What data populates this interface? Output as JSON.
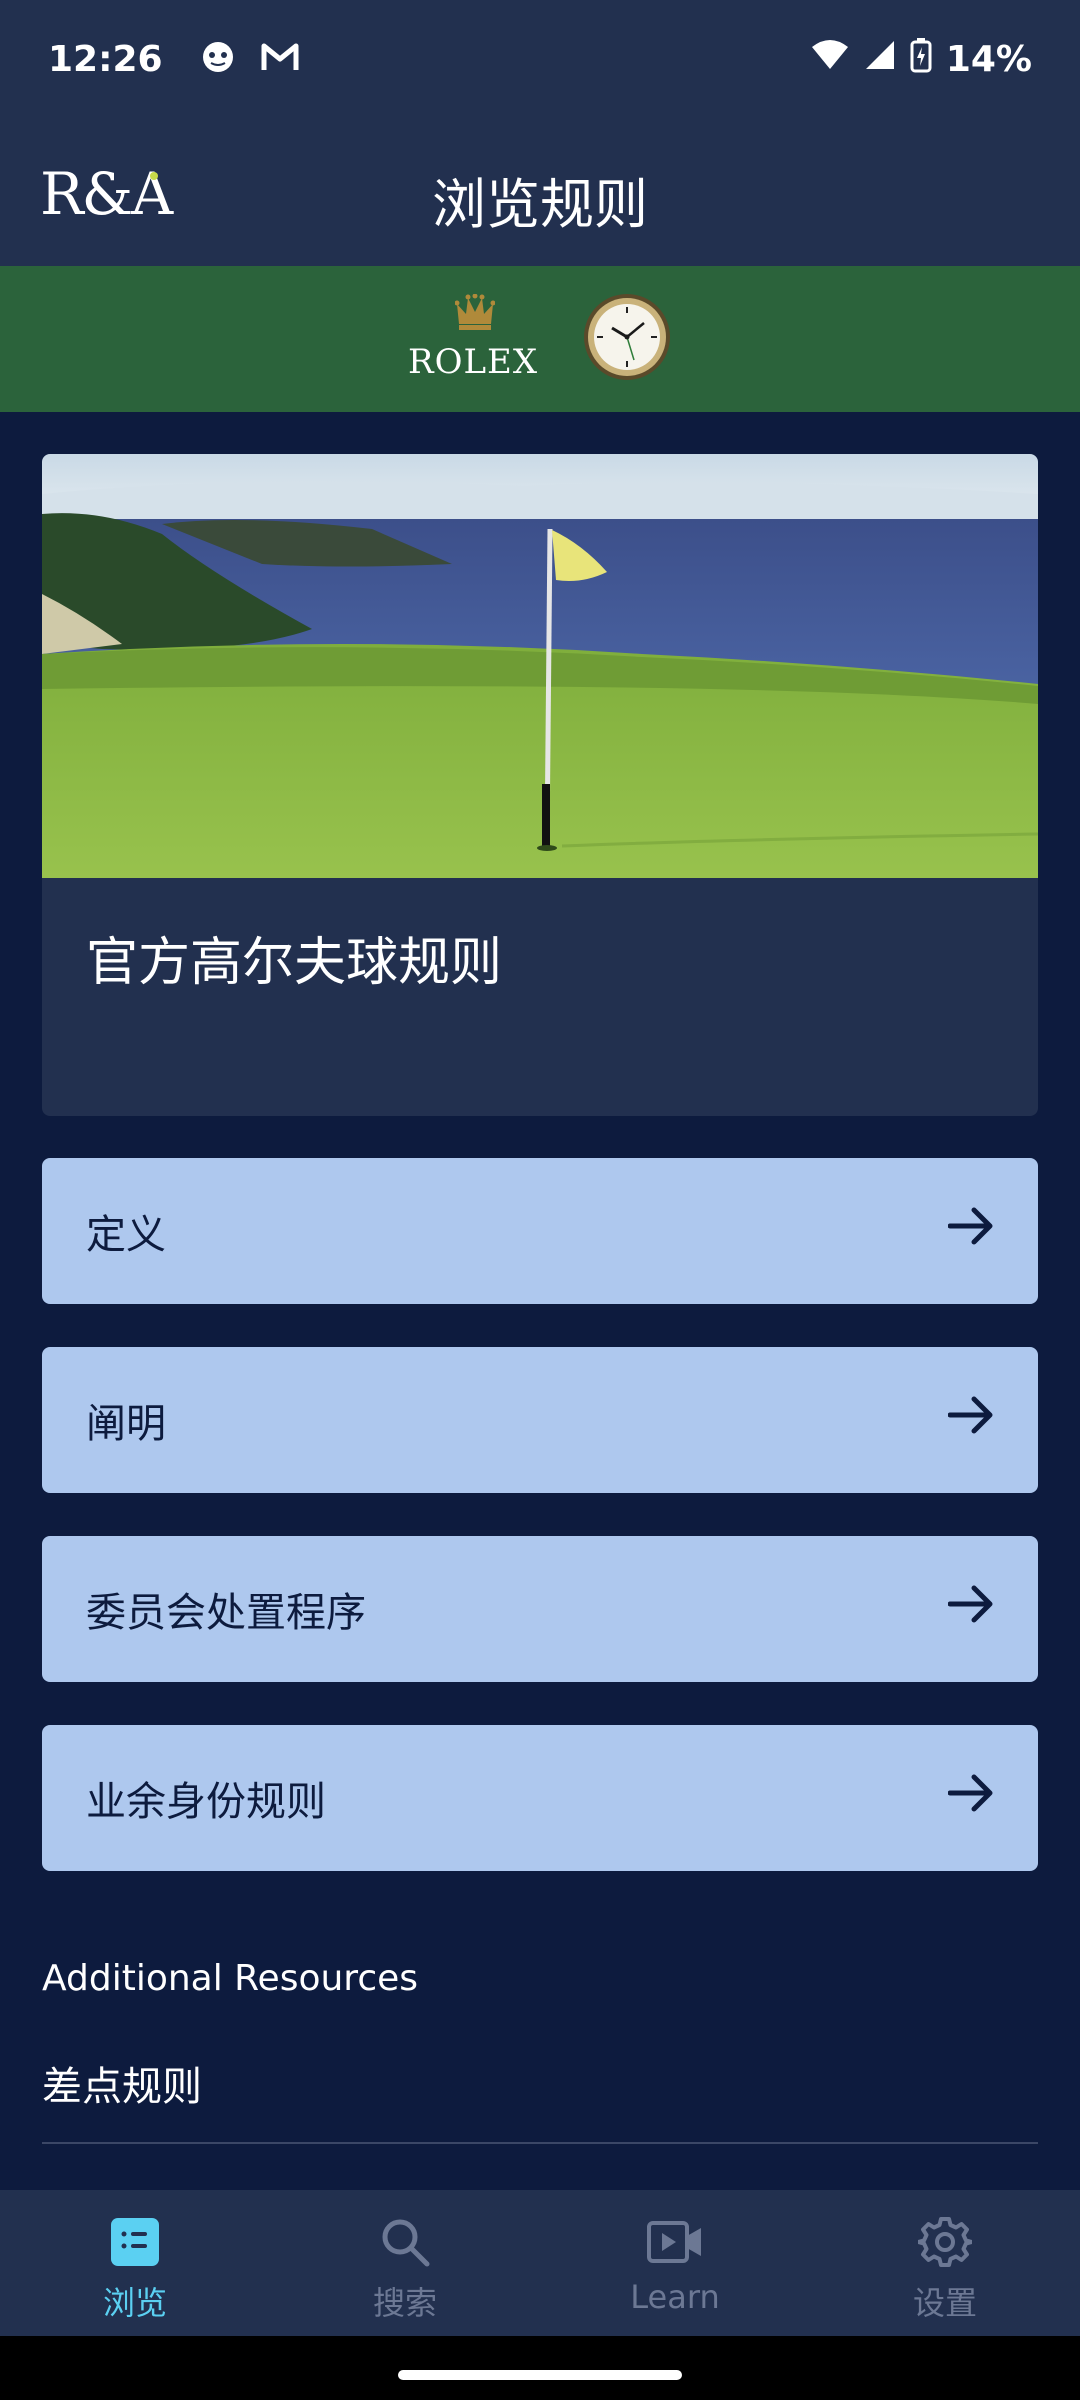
{
  "status_bar": {
    "time": "12:26",
    "battery": "14%",
    "icons": [
      "notification-face-icon",
      "gmail-icon",
      "wifi-icon",
      "signal-icon",
      "battery-charging-icon"
    ]
  },
  "header": {
    "logo": "R&A",
    "title": "浏览规则"
  },
  "sponsor": {
    "brand": "ROLEX"
  },
  "hero": {
    "title": "官方高尔夫球规则"
  },
  "rules": [
    {
      "label": "定义"
    },
    {
      "label": "阐明"
    },
    {
      "label": "委员会处置程序"
    },
    {
      "label": "业余身份规则"
    }
  ],
  "additional": {
    "title": "Additional Resources",
    "items": [
      {
        "label": "差点规则"
      }
    ]
  },
  "bottom_nav": {
    "items": [
      {
        "label": "浏览",
        "icon": "browse-list-icon",
        "active": true
      },
      {
        "label": "搜索",
        "icon": "search-icon",
        "active": false
      },
      {
        "label": "Learn",
        "icon": "video-icon",
        "active": false
      },
      {
        "label": "设置",
        "icon": "gear-icon",
        "active": false
      }
    ]
  },
  "colors": {
    "background": "#0d1b3e",
    "header": "#22304f",
    "sponsor_band": "#2b633b",
    "list_item": "#aec8ee",
    "nav_active": "#5bd0f2",
    "nav_inactive": "#6c7894"
  }
}
